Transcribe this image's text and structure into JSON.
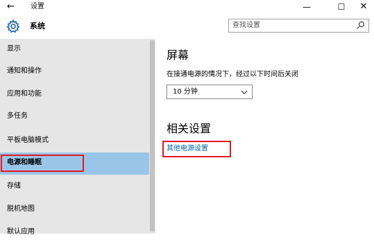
{
  "titlebar": {
    "back_glyph": "←",
    "title": "设置",
    "minimize_glyph": "—",
    "maximize_glyph": "☐",
    "close_glyph": "✕"
  },
  "header": {
    "icon": "gear-icon",
    "title": "系统",
    "search_placeholder": "查找设置",
    "search_icon": "search-icon"
  },
  "sidebar": {
    "items": [
      {
        "label": "显示",
        "selected": false
      },
      {
        "label": "通知和操作",
        "selected": false
      },
      {
        "label": "应用和功能",
        "selected": false
      },
      {
        "label": "多任务",
        "selected": false
      },
      {
        "label": "平板电脑模式",
        "selected": false
      },
      {
        "label": "电源和睡眠",
        "selected": true
      },
      {
        "label": "存储",
        "selected": false
      },
      {
        "label": "脱机地图",
        "selected": false
      },
      {
        "label": "默认应用",
        "selected": false
      }
    ]
  },
  "main": {
    "screen_heading": "屏幕",
    "screen_description": "在接通电源的情况下，经过以下时间后关闭",
    "screen_timeout_value": "10 分钟",
    "related_heading": "相关设置",
    "power_settings_link": "其他电源设置"
  },
  "colors": {
    "sidebar_bg": "#e6e6e6",
    "selected_bg": "#99c6e8",
    "link": "#0063b1",
    "highlight_box": "#e8141c"
  }
}
